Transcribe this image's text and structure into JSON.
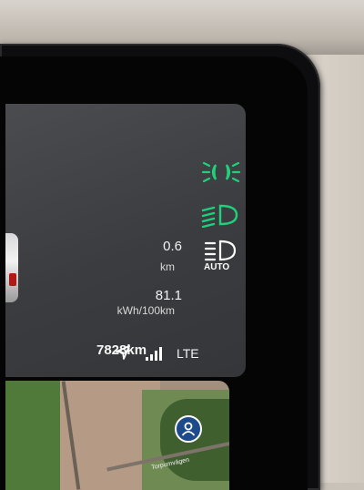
{
  "trip": {
    "distance_value": "0.6",
    "distance_unit": "km",
    "consumption_value": "81.1",
    "consumption_unit": "kWh/100km",
    "odometer": "7828km"
  },
  "indicators": {
    "parking_light_icon": "parking-light-icon",
    "low_beam_icon": "low-beam-icon",
    "auto_headlight_icon": "auto-headlight-icon",
    "auto_label": "AUTO",
    "active_color": "#1fd17a"
  },
  "status_bar": {
    "network": "LTE",
    "nav_icon": "navigation-arrow-icon",
    "signal_icon": "signal-strength-icon"
  },
  "map": {
    "road_label": "Torpumvägen",
    "profile_icon": "profile-icon"
  }
}
